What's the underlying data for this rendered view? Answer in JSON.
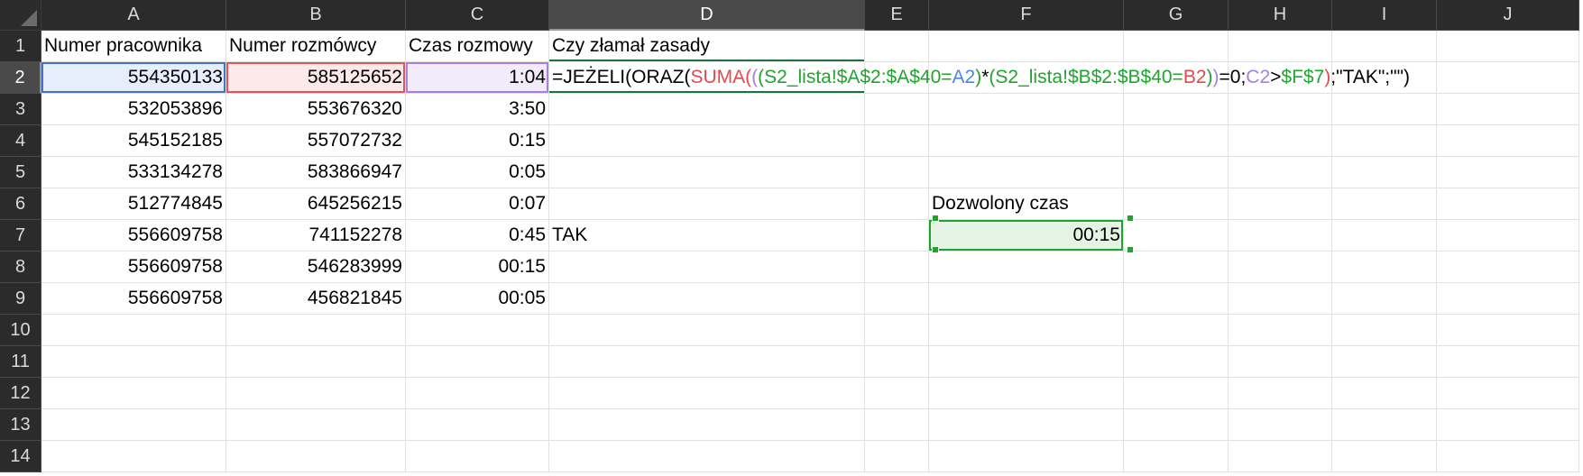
{
  "columns": [
    "A",
    "B",
    "C",
    "D",
    "E",
    "F",
    "G",
    "H",
    "I",
    "J"
  ],
  "rows": [
    "1",
    "2",
    "3",
    "4",
    "5",
    "6",
    "7",
    "8",
    "9",
    "10",
    "11",
    "12",
    "13",
    "14"
  ],
  "headers": {
    "a1": "Numer pracownika",
    "b1": "Numer rozmówcy",
    "c1": "Czas rozmowy",
    "d1": "Czy złamał zasady"
  },
  "data_rows": [
    {
      "a": "554350133",
      "b": "585125652",
      "c": "1:04"
    },
    {
      "a": "532053896",
      "b": "553676320",
      "c": "3:50"
    },
    {
      "a": "545152185",
      "b": "557072732",
      "c": "0:15"
    },
    {
      "a": "533134278",
      "b": "583866947",
      "c": "0:05"
    },
    {
      "a": "512774845",
      "b": "645256215",
      "c": "0:07"
    },
    {
      "a": "556609758",
      "b": "741152278",
      "c": "0:45"
    },
    {
      "a": "556609758",
      "b": "546283999",
      "c": "00:15"
    },
    {
      "a": "556609758",
      "b": "456821845",
      "c": "00:05"
    }
  ],
  "d7": "TAK",
  "f6": "Dozwolony czas",
  "f7": "00:15",
  "formula": {
    "p1": "=JEŻELI(ORAZ(",
    "p2": "SUMA(",
    "p3": "(",
    "p4": "(S2_lista!$A$2:$A$40=",
    "p5": "A2",
    "p6": ")",
    "p7": " *",
    "p8": "(S2_lista!$B$2:$B$40=",
    "p9": "B2",
    "p10": ")",
    "p11": ")",
    "p12": "=0;",
    "p13": "C2",
    "p14": ">",
    "p15": "$F$7",
    "p16": ")",
    "p17": ";\"TAK\";\"\")"
  },
  "colors": {
    "header_bg": "#2b2b2b",
    "ref_a": "#4472c4",
    "ref_b": "#e05555",
    "ref_c": "#a77fe0",
    "ref_f": "#22a32f"
  }
}
